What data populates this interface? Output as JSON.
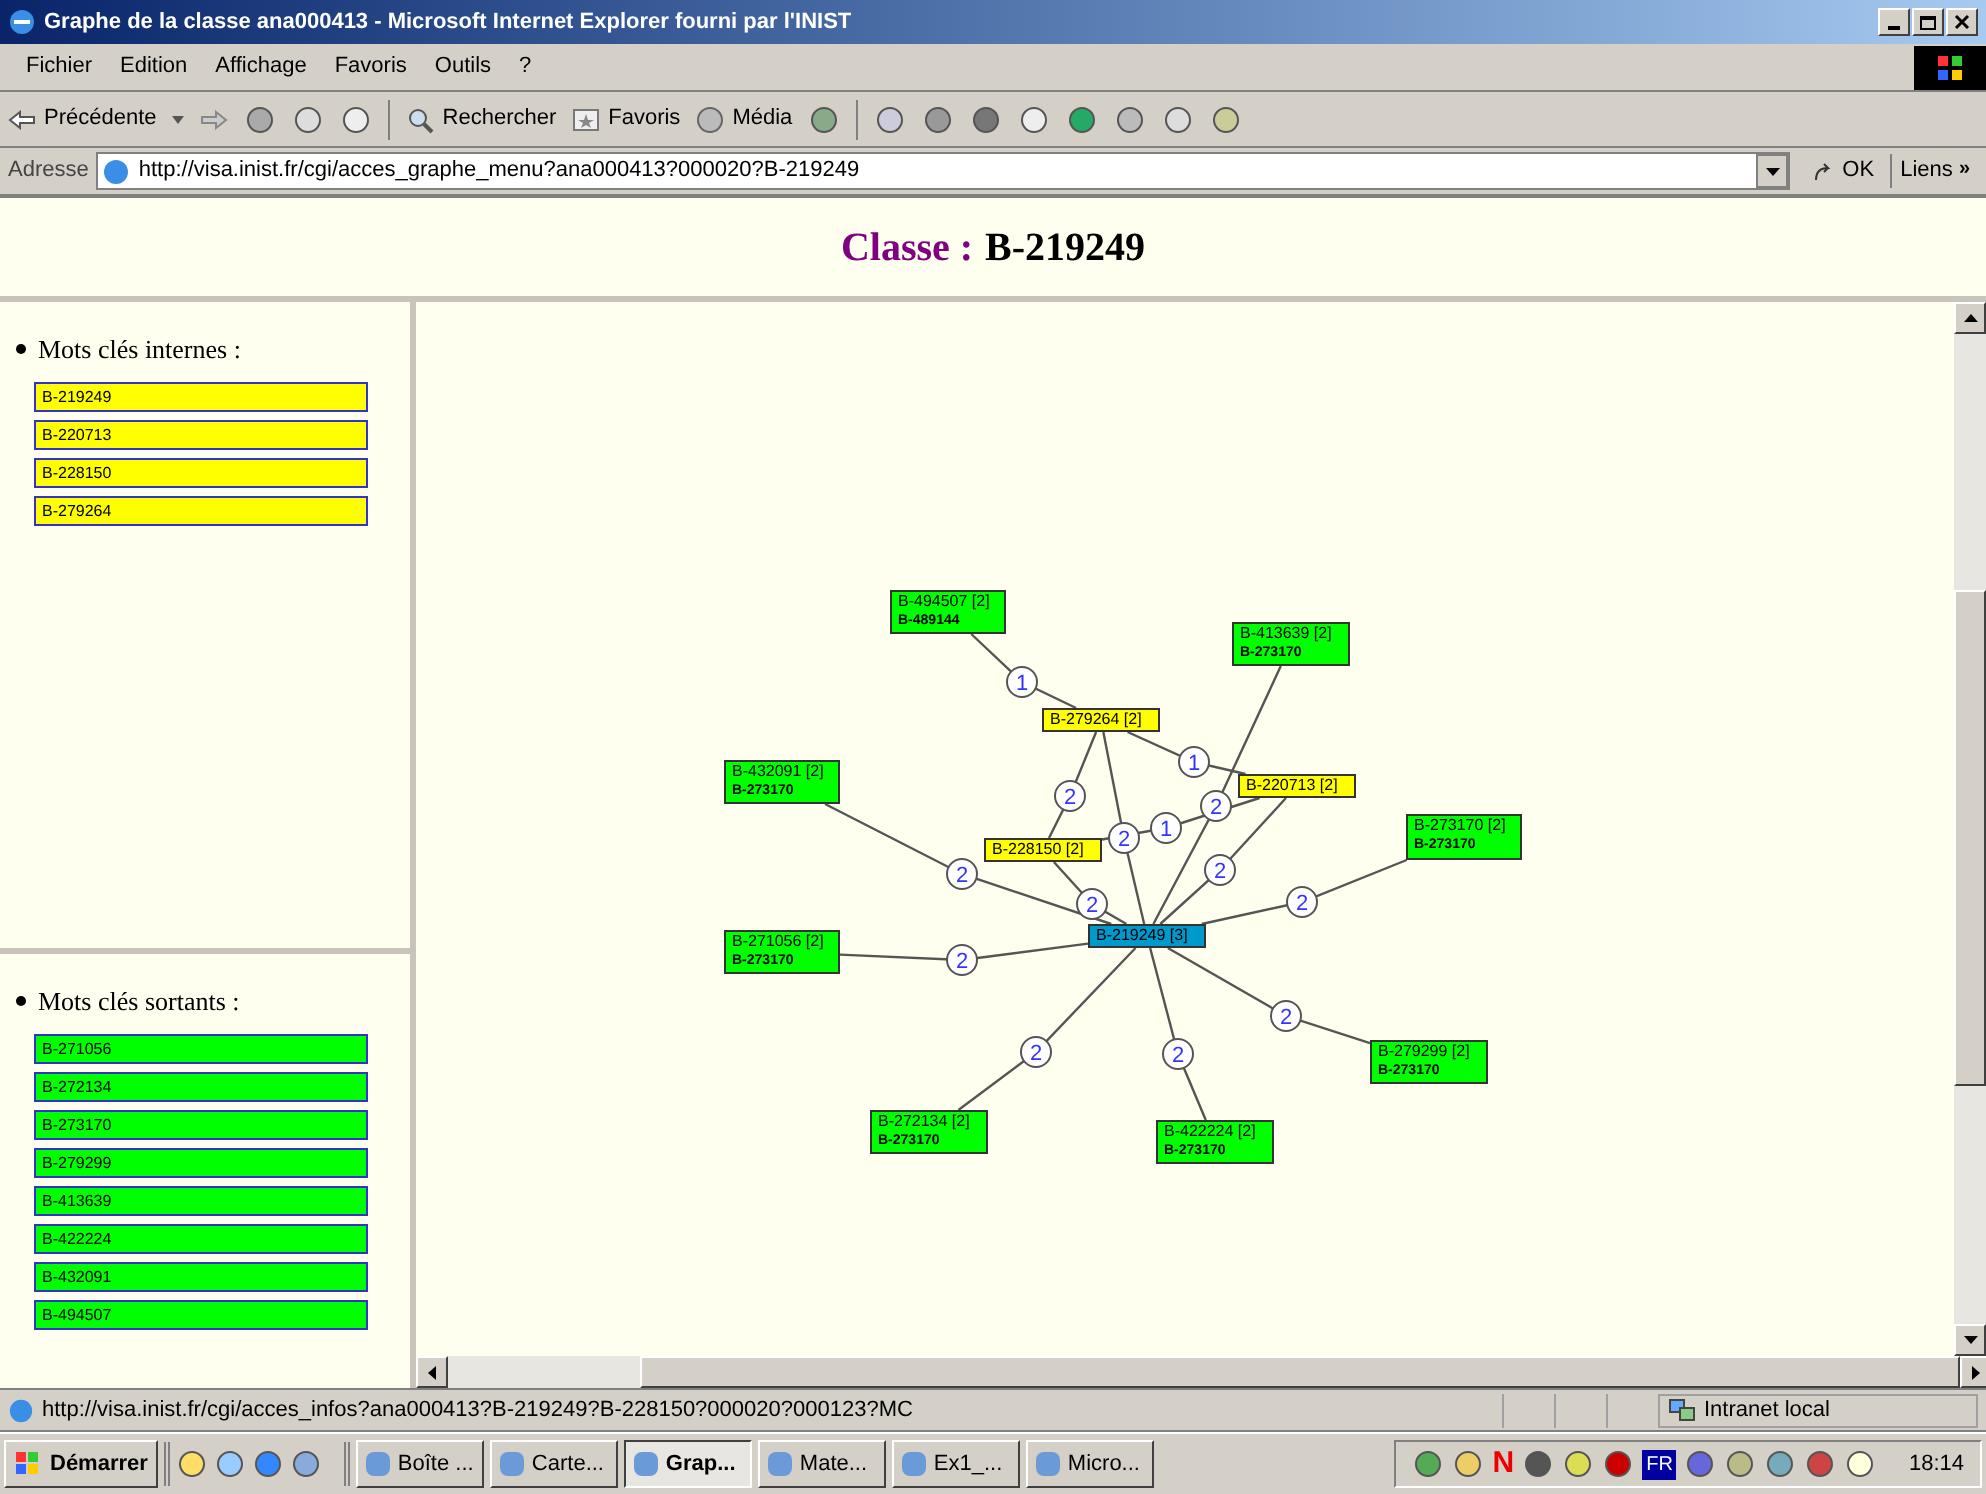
{
  "window": {
    "title": "Graphe de la classe ana000413 - Microsoft Internet Explorer fourni par l'INIST"
  },
  "menu_bar": [
    "Fichier",
    "Edition",
    "Affichage",
    "Favoris",
    "Outils",
    "?"
  ],
  "toolbar": {
    "back": "Précédente",
    "search": "Rechercher",
    "favorites": "Favoris",
    "media": "Média"
  },
  "address_bar": {
    "label": "Adresse",
    "value": "http://visa.inist.fr/cgi/acces_graphe_menu?ana000413?000020?B-219249",
    "go": "OK",
    "links": "Liens",
    "more": "»"
  },
  "heading": {
    "prefix": "Classe :",
    "value": "B-219249"
  },
  "internal_keywords": {
    "title": "Mots clés internes :",
    "items": [
      "B-219249",
      "B-220713",
      "B-228150",
      "B-279264"
    ]
  },
  "outgoing_keywords": {
    "title": "Mots clés sortants :",
    "items": [
      "B-271056",
      "B-272134",
      "B-273170",
      "B-279299",
      "B-413639",
      "B-422224",
      "B-432091",
      "B-494507"
    ]
  },
  "graph": {
    "nodes": [
      {
        "label": "B-494507 [2]",
        "sublabel": "B-489144",
        "kind": "outgoing"
      },
      {
        "label": "B-413639 [2]",
        "sublabel": "B-273170",
        "kind": "outgoing"
      },
      {
        "label": "B-279264 [2]",
        "kind": "internal"
      },
      {
        "label": "B-432091 [2]",
        "sublabel": "B-273170",
        "kind": "outgoing"
      },
      {
        "label": "B-220713 [2]",
        "kind": "internal"
      },
      {
        "label": "B-273170 [2]",
        "sublabel": "B-273170",
        "kind": "outgoing"
      },
      {
        "label": "B-228150 [2]",
        "kind": "internal"
      },
      {
        "label": "B-219249 [3]",
        "kind": "current"
      },
      {
        "label": "B-271056 [2]",
        "sublabel": "B-273170",
        "kind": "outgoing"
      },
      {
        "label": "B-279299 [2]",
        "sublabel": "B-273170",
        "kind": "outgoing"
      },
      {
        "label": "B-272134 [2]",
        "sublabel": "B-273170",
        "kind": "outgoing"
      },
      {
        "label": "B-422224 [2]",
        "sublabel": "B-273170",
        "kind": "outgoing"
      }
    ],
    "edges": [
      {
        "weight": "1"
      },
      {
        "weight": "1"
      },
      {
        "weight": "2"
      },
      {
        "weight": "2"
      },
      {
        "weight": "1"
      },
      {
        "weight": "2"
      },
      {
        "weight": "2"
      },
      {
        "weight": "2"
      },
      {
        "weight": "2"
      },
      {
        "weight": "2"
      },
      {
        "weight": "2"
      },
      {
        "weight": "2"
      },
      {
        "weight": "2"
      },
      {
        "weight": "2"
      }
    ]
  },
  "status_bar": {
    "url": "http://visa.inist.fr/cgi/acces_infos?ana000413?B-219249?B-228150?000020?000123?MC",
    "zone": "Intranet local"
  },
  "taskbar": {
    "start": "Démarrer",
    "tasks": [
      {
        "label": "Boîte ...",
        "selected": false
      },
      {
        "label": "Carte...",
        "selected": false
      },
      {
        "label": "Grap...",
        "selected": true
      },
      {
        "label": "Mate...",
        "selected": false
      },
      {
        "label": "Ex1_...",
        "selected": false
      },
      {
        "label": "Micro...",
        "selected": false
      }
    ],
    "tray": {
      "n": "N",
      "language": "FR"
    },
    "clock": "18:14"
  }
}
